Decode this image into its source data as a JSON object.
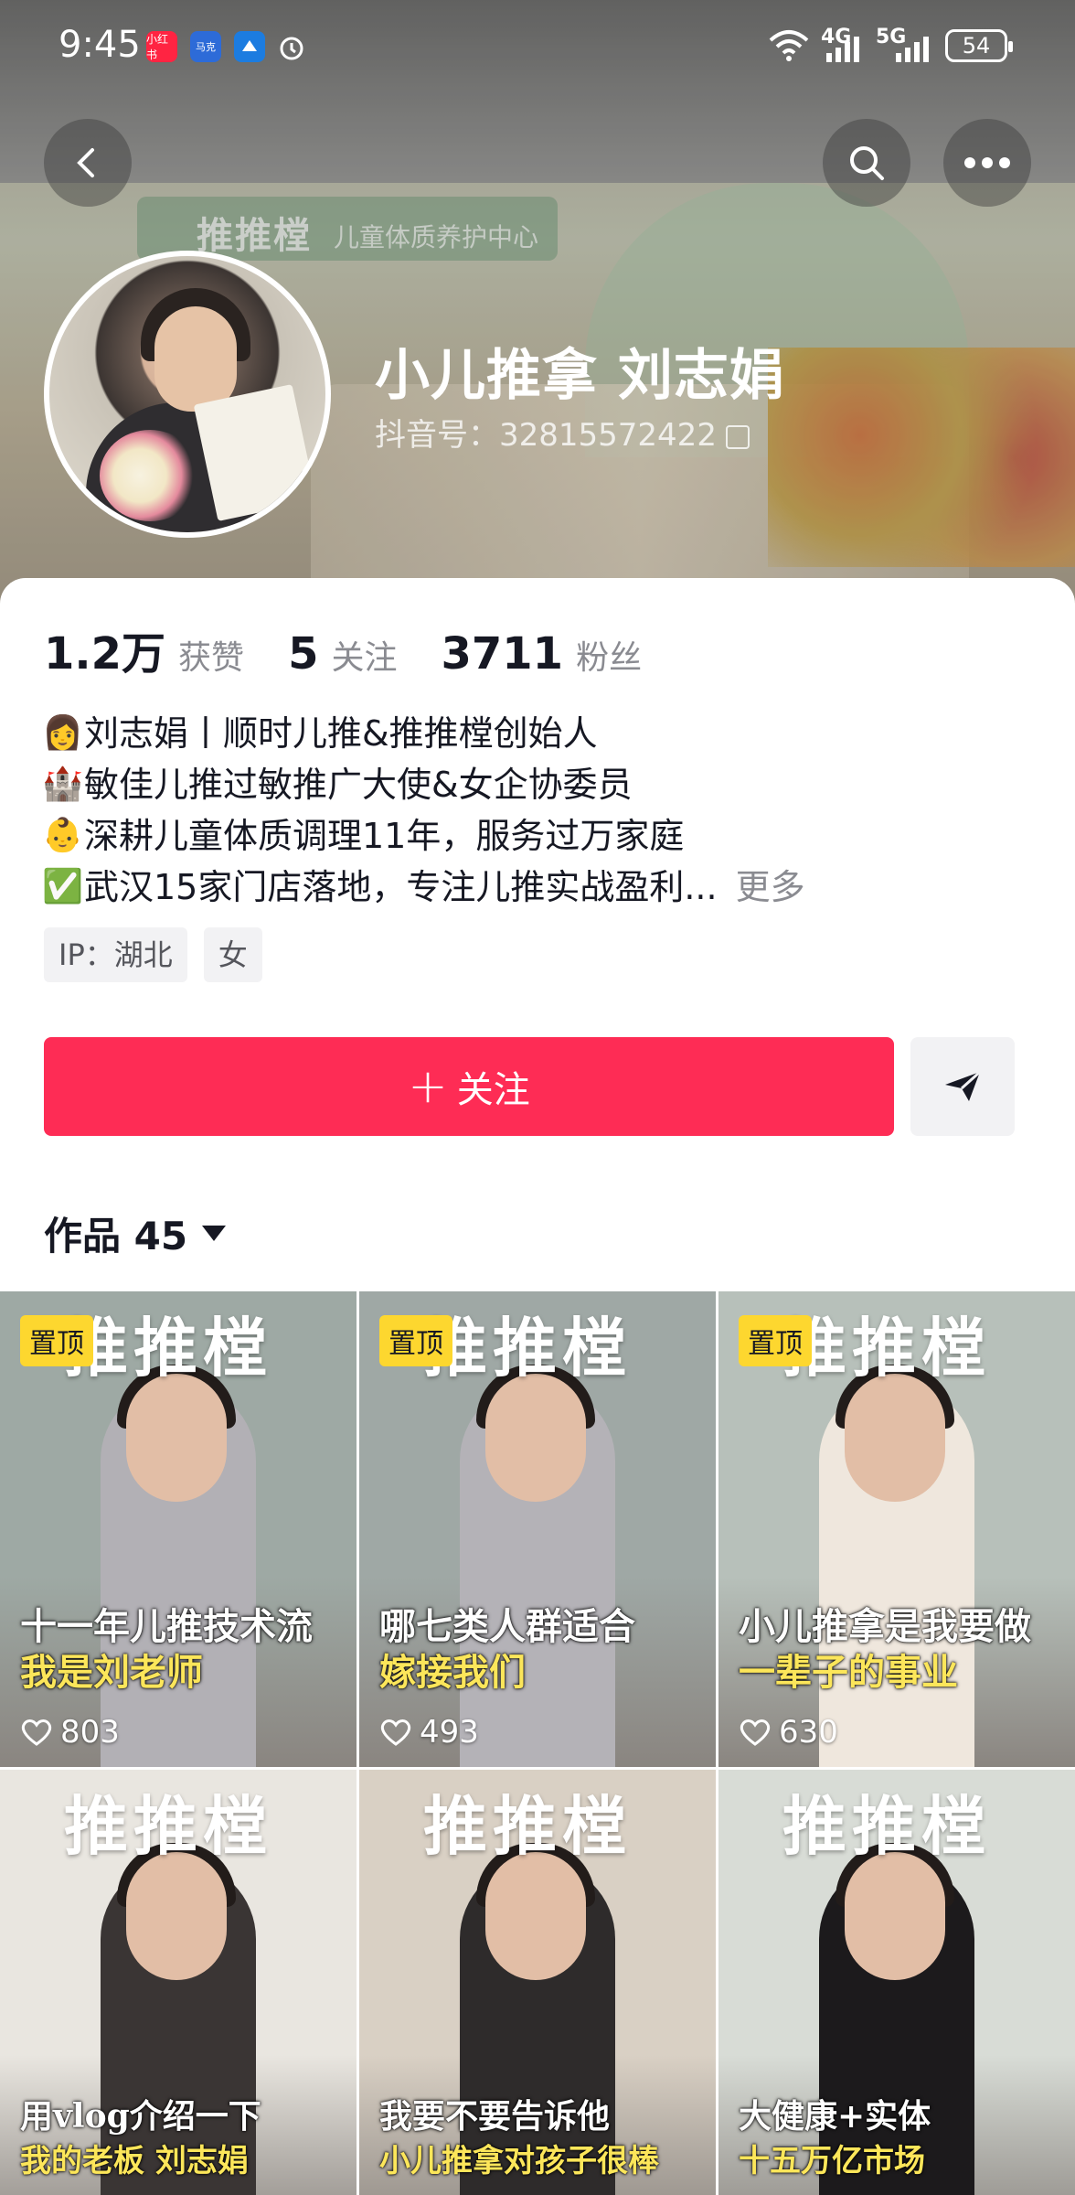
{
  "status_bar": {
    "time": "9:45",
    "apps": [
      "小红书",
      "马克",
      "",
      ""
    ],
    "net1": "4G",
    "net2": "5G",
    "battery": "54"
  },
  "header": {
    "back_icon": "chevron-left-icon",
    "search_icon": "search-icon",
    "more_icon": "more-horizontal-icon"
  },
  "banner": {
    "sign_text": "推推樘",
    "sign_sub": "儿童体质养护中心"
  },
  "profile": {
    "name": "小儿推拿 刘志娟",
    "douyin_id": "抖音号：32815572422"
  },
  "stats": [
    {
      "value": "1.2万",
      "label": "获赞"
    },
    {
      "value": "5",
      "label": "关注"
    },
    {
      "value": "3711",
      "label": "粉丝"
    }
  ],
  "bio": [
    {
      "emoji": "👩",
      "text": "刘志娟丨顺时儿推&推推樘创始人"
    },
    {
      "emoji": "🏰",
      "text": "敏佳儿推过敏推广大使&女企协委员"
    },
    {
      "emoji": "👶",
      "text": "深耕儿童体质调理11年，服务过万家庭"
    },
    {
      "emoji": "✅",
      "text": "武汉15家门店落地，专注儿推实战盈利..."
    }
  ],
  "bio_more": "更多",
  "tags": [
    "IP：湖北",
    "女"
  ],
  "follow_label": "关注",
  "works_label": "作品 45",
  "accent": "#fe2c55",
  "videos": [
    {
      "pinned": "置顶",
      "brand": "推推樘",
      "cap1": "十一年儿推技术流",
      "cap2": "我是刘老师",
      "likes": "803",
      "bg": "#9ea9a4",
      "shirt": "#b2b0b5"
    },
    {
      "pinned": "置顶",
      "brand": "推推樘",
      "cap1": "哪七类人群适合",
      "cap2": "嫁接我们",
      "likes": "493",
      "bg": "#9fa8a5",
      "shirt": "#b4b2b7"
    },
    {
      "pinned": "置顶",
      "brand": "推推樘",
      "cap1": "小儿推拿是我要做",
      "cap2": "一辈子的事业",
      "likes": "630",
      "bg": "#b7c0ba",
      "shirt": "#efe7dd"
    },
    {
      "pinned": "",
      "brand": "推推樘",
      "cap1": "用vlog介绍一下",
      "cap2": "我的老板 刘志娟",
      "likes": "",
      "bg": "#e9e6e0",
      "shirt": "#3a3534"
    },
    {
      "pinned": "",
      "brand": "推推樘",
      "cap1": "我要不要告诉他",
      "cap2": "小儿推拿对孩子很棒",
      "likes": "",
      "bg": "#d9d0c4",
      "shirt": "#2e2b2b"
    },
    {
      "pinned": "",
      "brand": "推推樘",
      "cap1": "大健康+实体",
      "cap2": "十五万亿市场",
      "likes": "",
      "bg": "#d8dcd6",
      "shirt": "#1c1a1c"
    }
  ]
}
